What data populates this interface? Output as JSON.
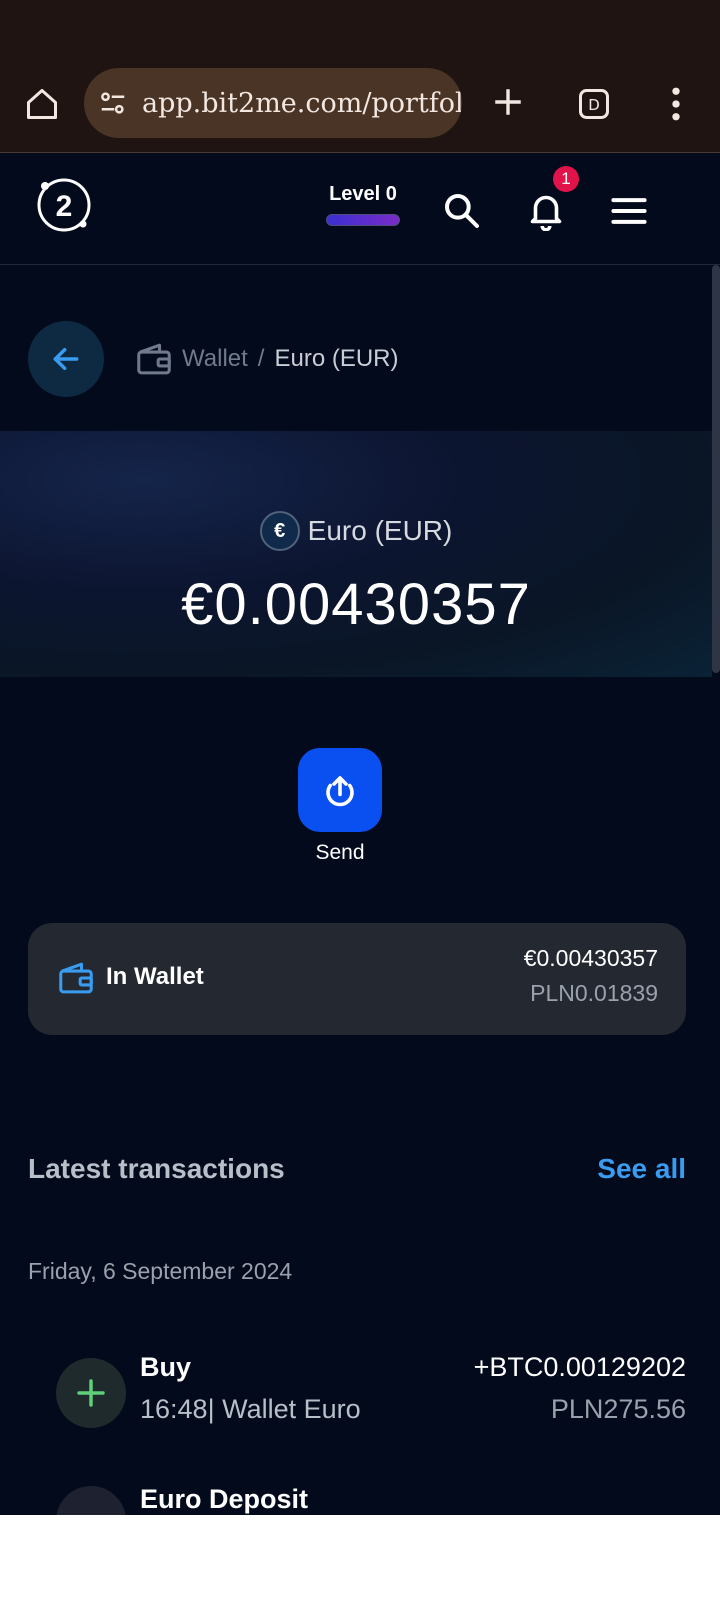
{
  "browser": {
    "url": "app.bit2me.com/portfol",
    "icons": [
      "home-icon",
      "site-settings-icon",
      "plus-icon",
      "tab-switcher-icon",
      "more-vert-icon"
    ]
  },
  "header": {
    "logo_text": "2",
    "level_label": "Level 0",
    "notification_count": "1",
    "colors": {
      "badge": "#e0134b",
      "background": "#020a1b"
    }
  },
  "breadcrumb": {
    "wallet": "Wallet",
    "separator": "/",
    "current": "Euro (EUR)"
  },
  "balance": {
    "coin_symbol": "€",
    "coin_name": "Euro (EUR)",
    "amount": "€0.00430357"
  },
  "actions": {
    "send_label": "Send",
    "accent": "#0a4ff0"
  },
  "wallet_card": {
    "label": "In Wallet",
    "amount": "€0.00430357",
    "fiat": "PLN0.01839"
  },
  "transactions": {
    "title": "Latest transactions",
    "see_all": "See all",
    "date": "Friday, 6 September 2024",
    "items": [
      {
        "type": "Buy",
        "subtitle": "16:48| Wallet Euro",
        "amount": "+BTC0.00129202",
        "fiat": "PLN275.56",
        "icon": "plus-icon"
      },
      {
        "type": "Euro Deposit",
        "icon": "deposit-icon"
      }
    ]
  }
}
